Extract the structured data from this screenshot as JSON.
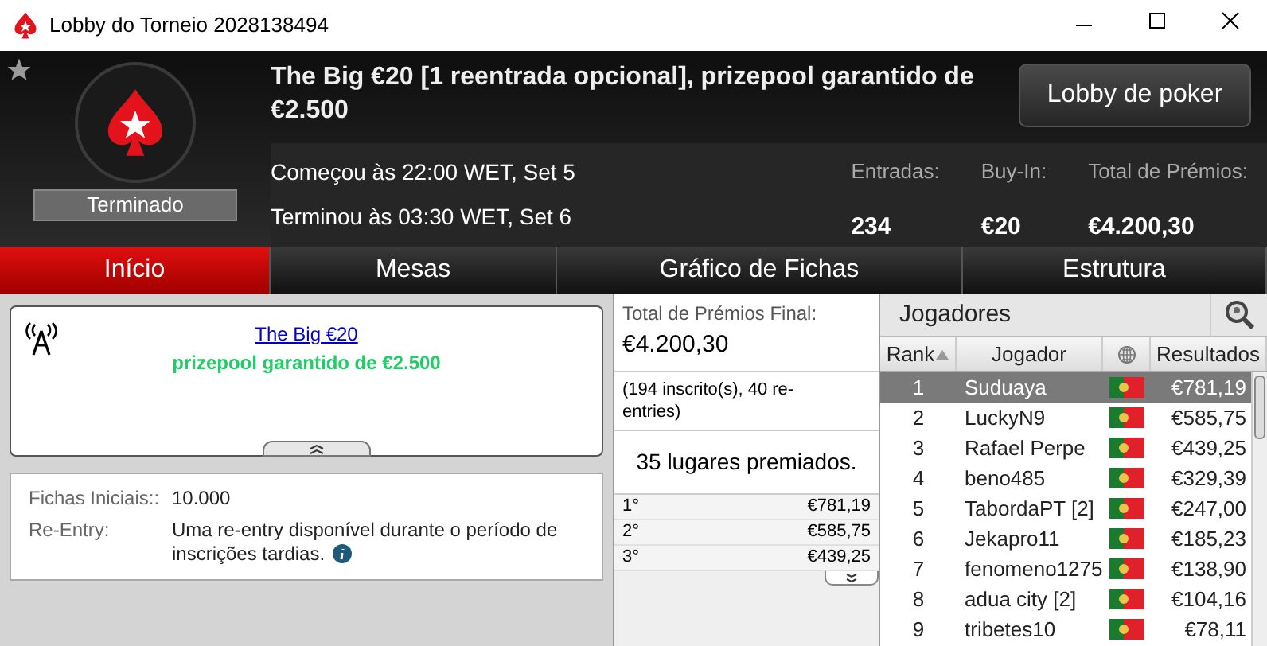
{
  "window": {
    "title": "Lobby do Torneio 2028138494"
  },
  "header": {
    "title": "The Big €20 [1 reentrada opcional], prizepool garantido de €2.500",
    "status": "Terminado",
    "started": "Começou às 22:00 WET, Set 5",
    "ended": "Terminou às 03:30 WET, Set 6",
    "lobby_button": "Lobby de poker",
    "stats": [
      {
        "label": "Entradas:",
        "value": "234"
      },
      {
        "label": "Buy-In:",
        "value": "€20"
      },
      {
        "label": "Total de Prémios:",
        "value": "€4.200,30"
      }
    ]
  },
  "tabs": [
    {
      "label": "Início",
      "selected": true
    },
    {
      "label": "Mesas",
      "selected": false
    },
    {
      "label": "Gráfico de Fichas",
      "selected": false
    },
    {
      "label": "Estrutura",
      "selected": false
    }
  ],
  "news": {
    "link": "The Big €20",
    "subtitle": "prizepool garantido de €2.500"
  },
  "info": [
    {
      "label": "Fichas Iniciais::",
      "value": "10.000",
      "has_info": false
    },
    {
      "label": "Re-Entry:",
      "value": "Uma re-entry disponível durante o período de inscrições tardias.",
      "has_info": true
    }
  ],
  "prizes": {
    "title": "Total de Prémios Final:",
    "total": "€4.200,30",
    "entries_note": "(194 inscrito(s), 40 re-entries)",
    "places": "35 lugares premiados.",
    "payouts": [
      {
        "place": "1°",
        "amount": "€781,19"
      },
      {
        "place": "2°",
        "amount": "€585,75"
      },
      {
        "place": "3°",
        "amount": "€439,25"
      }
    ]
  },
  "players": {
    "title": "Jogadores",
    "columns": [
      {
        "kind": "text",
        "label": "Rank",
        "sorted": true
      },
      {
        "kind": "text",
        "label": "Jogador",
        "sorted": false
      },
      {
        "kind": "globe",
        "sorted": false
      },
      {
        "kind": "text",
        "label": "Resultados",
        "sorted": false
      }
    ],
    "rows": [
      {
        "rank": "1",
        "name": "Suduaya",
        "result": "€781,19",
        "selected": true
      },
      {
        "rank": "2",
        "name": "LuckyN9",
        "result": "€585,75",
        "selected": false
      },
      {
        "rank": "3",
        "name": "Rafael Perpe",
        "result": "€439,25",
        "selected": false
      },
      {
        "rank": "4",
        "name": "beno485",
        "result": "€329,39",
        "selected": false
      },
      {
        "rank": "5",
        "name": "TabordaPT [2]",
        "result": "€247,00",
        "selected": false
      },
      {
        "rank": "6",
        "name": "Jekapro11",
        "result": "€185,23",
        "selected": false
      },
      {
        "rank": "7",
        "name": "fenomeno1275",
        "result": "€138,90",
        "selected": false
      },
      {
        "rank": "8",
        "name": "adua city [2]",
        "result": "€104,16",
        "selected": false
      },
      {
        "rank": "9",
        "name": "tribetes10",
        "result": "€78,11",
        "selected": false
      }
    ]
  }
}
